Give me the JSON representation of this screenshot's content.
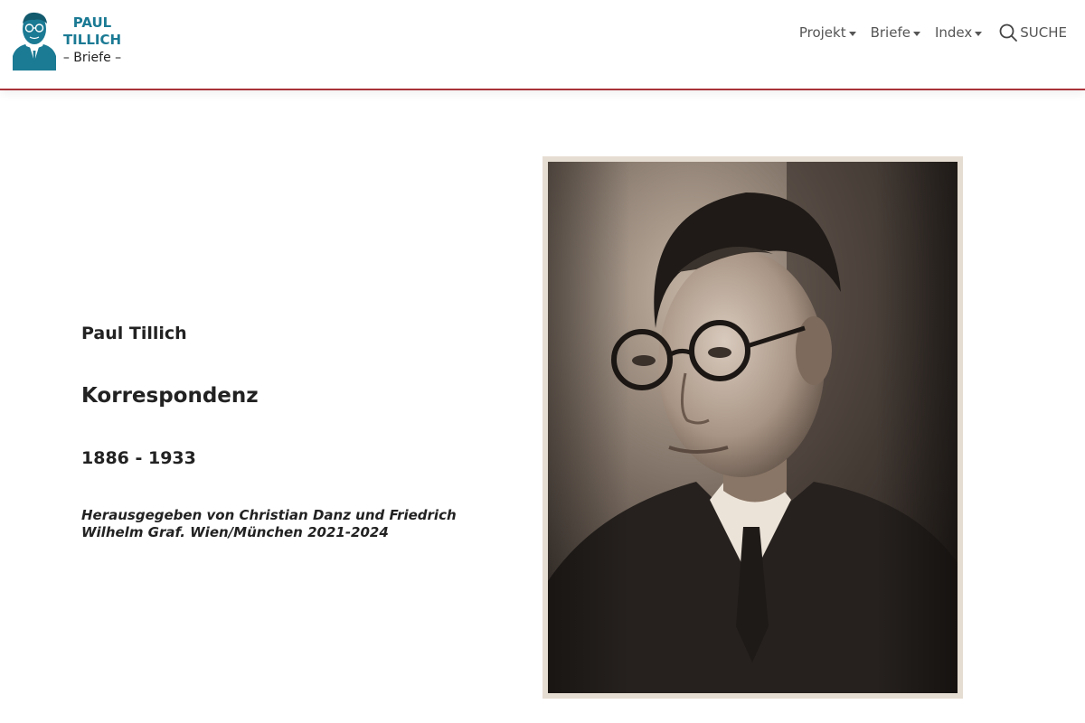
{
  "logo": {
    "line1": "PAUL",
    "line2": "TILLICH",
    "line3": "– Briefe –",
    "color": "#1b7a94"
  },
  "nav": {
    "items": [
      {
        "label": "Projekt",
        "icon": "caret-down-icon"
      },
      {
        "label": "Briefe",
        "icon": "caret-down-icon"
      },
      {
        "label": "Index",
        "icon": "caret-down-icon"
      }
    ],
    "search_label": "SUCHE",
    "search_icon": "search-icon",
    "accent_color": "#a8343a"
  },
  "main": {
    "name": "Paul Tillich",
    "title": "Korrespondenz",
    "years": "1886 - 1933",
    "editors": "Herausgegeben von Christian Danz und Friedrich Wilhelm Graf. Wien/München 2021-2024"
  }
}
